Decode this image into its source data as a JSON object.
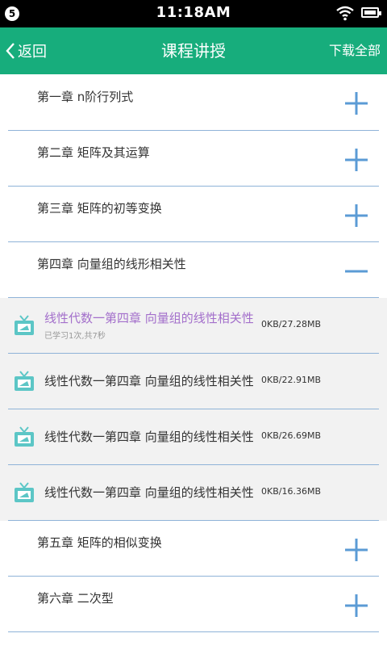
{
  "status": {
    "badge": "5",
    "time": "11:18AM"
  },
  "header": {
    "back_label": "返回",
    "title": "课程讲授",
    "download_all_label": "下载全部"
  },
  "chapters_before": [
    {
      "label": "第一章  n阶行列式",
      "state": "collapsed"
    },
    {
      "label": "第二章  矩阵及其运算",
      "state": "collapsed"
    },
    {
      "label": "第三章  矩阵的初等变换",
      "state": "collapsed"
    },
    {
      "label": "第四章  向量组的线形相关性",
      "state": "expanded"
    }
  ],
  "lessons": [
    {
      "title": "线性代数一第四章 向量组的线性相关性",
      "progress": "已学习1次,共7秒",
      "size": "0KB/27.28MB",
      "active": true
    },
    {
      "title": "线性代数一第四章 向量组的线性相关性",
      "size": "0KB/22.91MB",
      "active": false
    },
    {
      "title": "线性代数一第四章 向量组的线性相关性",
      "size": "0KB/26.69MB",
      "active": false
    },
    {
      "title": "线性代数一第四章 向量组的线性相关性",
      "size": "0KB/16.36MB",
      "active": false
    }
  ],
  "chapters_after": [
    {
      "label": "第五章  矩阵的相似变换",
      "state": "collapsed"
    },
    {
      "label": "第六章  二次型",
      "state": "collapsed"
    }
  ],
  "colors": {
    "header": "#17ad7c",
    "accent_icon": "#5b9bd5",
    "tv_icon": "#5cc6c6",
    "active_text": "#a36fcb"
  }
}
